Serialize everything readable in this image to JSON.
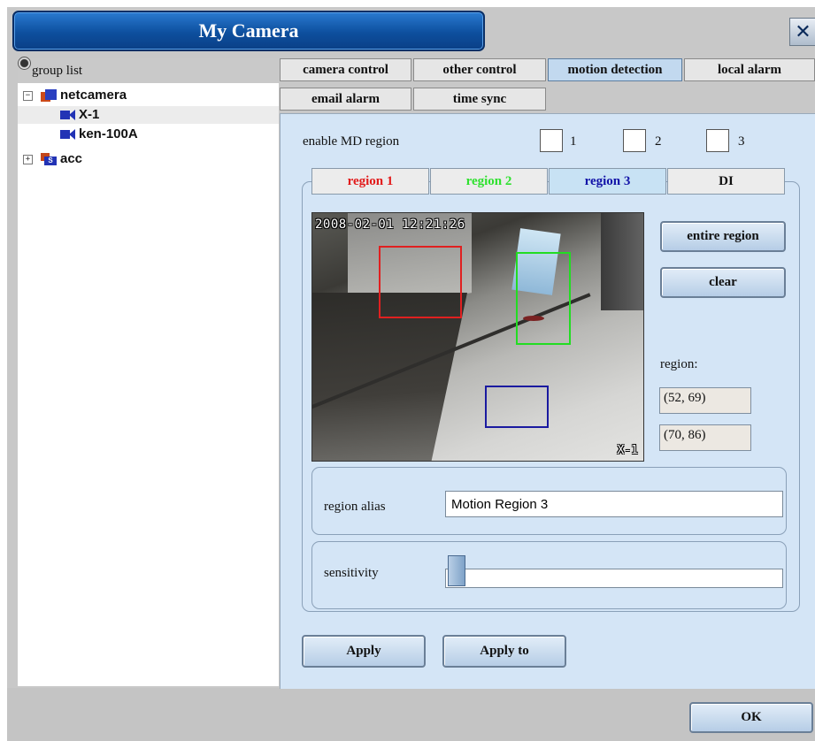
{
  "window": {
    "title": "My Camera",
    "close_label": "✕"
  },
  "tree": {
    "header": "group list",
    "nodes": [
      {
        "label": "netcamera",
        "type": "group",
        "expander": "−"
      },
      {
        "label": "X-1",
        "type": "camera",
        "selected": true
      },
      {
        "label": "ken-100A",
        "type": "camera"
      },
      {
        "label": "acc",
        "type": "group",
        "expander": "+"
      }
    ]
  },
  "tabs": {
    "row1": [
      "camera control",
      "other control",
      "motion detection",
      "local alarm"
    ],
    "row2": [
      "email alarm",
      "time sync"
    ],
    "active": "motion detection"
  },
  "enable": {
    "label": "enable MD region",
    "options": [
      "1",
      "2",
      "3"
    ]
  },
  "region_tabs": [
    {
      "label": "region 1",
      "color": "#e21b1b"
    },
    {
      "label": "region 2",
      "color": "#2fe12f"
    },
    {
      "label": "region 3",
      "color": "#1313a8"
    },
    {
      "label": "DI",
      "color": "#111111"
    }
  ],
  "preview": {
    "timestamp": "2008-02-01 12:21:26",
    "camera_label": "X-1",
    "regions": [
      {
        "name": "region 1",
        "color": "#e02020"
      },
      {
        "name": "region 2",
        "color": "#22dd22"
      },
      {
        "name": "region 3",
        "color": "#1a1aa0"
      }
    ]
  },
  "actions": {
    "entire_region": "entire region",
    "clear": "clear",
    "apply": "Apply",
    "apply_to": "Apply to",
    "ok": "OK"
  },
  "region_info": {
    "label": "region:",
    "start": "(52, 69)",
    "end": "(70, 86)"
  },
  "alias": {
    "label": "region alias",
    "value": "Motion Region 3"
  },
  "sensitivity": {
    "label": "sensitivity",
    "level": 0.0
  }
}
